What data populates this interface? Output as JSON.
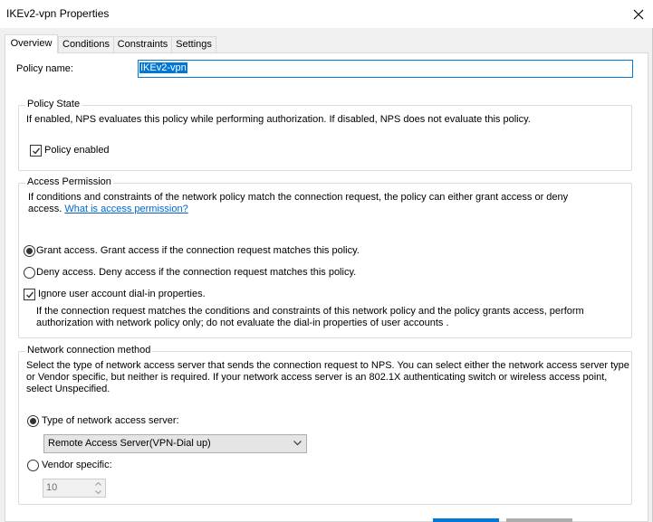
{
  "window": {
    "title": "IKEv2-vpn Properties"
  },
  "tabs": [
    "Overview",
    "Conditions",
    "Constraints",
    "Settings"
  ],
  "policy_name": {
    "label": "Policy name:",
    "value": "IKEv2-vpn"
  },
  "policy_state": {
    "title": "Policy State",
    "description": "If enabled, NPS evaluates this policy while performing authorization. If disabled, NPS does not evaluate this policy.",
    "enabled_label": "Policy enabled",
    "enabled": true
  },
  "access_permission": {
    "title": "Access Permission",
    "description_line1": "If conditions and constraints of the network policy match the connection request, the policy can either grant access or deny",
    "description_line2": "access.",
    "link": "What is access permission?",
    "grant_label": "Grant access. Grant access if the connection request matches this policy.",
    "deny_label": "Deny access. Deny access if the connection request matches this policy.",
    "selected": "grant",
    "ignore_dialin_label": "Ignore user account dial-in properties.",
    "ignore_dialin": true,
    "ignore_desc_line1": "If the connection request matches the conditions and constraints of this network policy and the policy grants access, perform",
    "ignore_desc_line2": "authorization with network policy only; do not evaluate the dial-in properties of user accounts ."
  },
  "network_method": {
    "title": "Network connection method",
    "desc_line1": "Select the type of network access server that sends the connection request to NPS. You can select either the network access server type",
    "desc_line2": "or Vendor specific, but neither is required.  If your network access server is an 802.1X authenticating switch or wireless access point,",
    "desc_line3": "select Unspecified.",
    "type_label": "Type of network access server:",
    "type_value": "Remote Access Server(VPN-Dial up)",
    "vendor_label": "Vendor specific:",
    "vendor_value": "10",
    "selected": "type"
  },
  "colors": {
    "accent": "#0078d7",
    "link": "#0066cc"
  }
}
